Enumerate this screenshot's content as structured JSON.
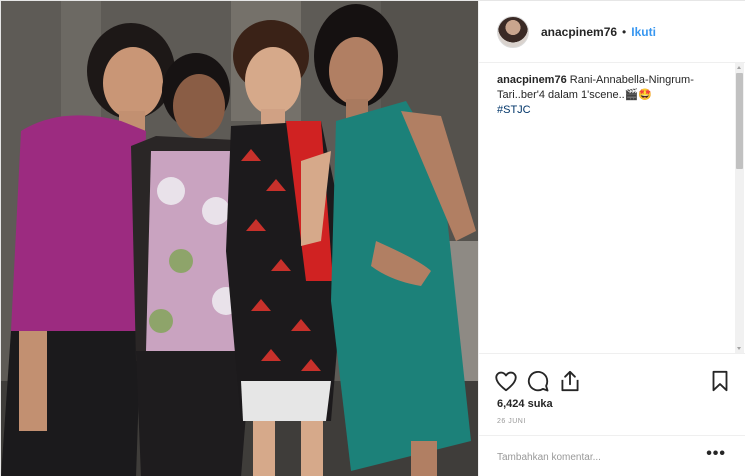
{
  "post": {
    "username": "anacpinem76",
    "separator": "•",
    "follow_label": "Ikuti",
    "caption_user": "anacpinem76",
    "caption_text": " Rani-Annabella-Ningrum-Tari..ber'4 dalam 1'scene..🎬🤩",
    "hashtag": "#STJC",
    "likes_count": "6,424",
    "likes_word": "suka",
    "date": "26 JUNI",
    "comment_placeholder": "Tambahkan komentar...",
    "more_label": "•••"
  },
  "icons": {
    "like": "heart-icon",
    "comment": "speech-bubble-icon",
    "share": "share-icon",
    "save": "bookmark-icon"
  },
  "colors": {
    "follow_blue": "#3897f0",
    "hashtag_blue": "#003569",
    "text": "#262626",
    "muted": "#999999"
  }
}
